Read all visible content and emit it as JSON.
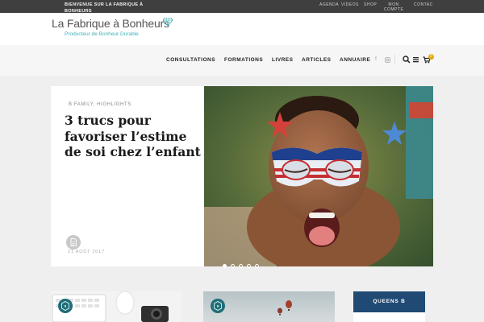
{
  "topbar": {
    "welcome": "BIENVENUE SUR LA FABRIQUE À BONHEURS",
    "links": [
      "AGENDA",
      "VIDEOS",
      "SHOP",
      "MON COMPTE",
      "CONTAC"
    ]
  },
  "header": {
    "logo_title": "La Fabrique à Bonheurs",
    "logo_sub": "Producteur de Bonheur Durable"
  },
  "nav": {
    "items": [
      "CONSULTATIONS",
      "FORMATIONS",
      "LIVRES",
      "ARTICLES",
      "ANNUAIRE"
    ],
    "cart_count": "0"
  },
  "hero": {
    "category": "B FAMILY, HIGHLIGHTS",
    "title": "3 trucs pour favoriser l’estime de soi chez l’enfant",
    "date": "21 AOÛT 2017",
    "slides": 5,
    "active_slide": 0
  },
  "widgets": {
    "queens_label": "QUEENS B"
  },
  "colors": {
    "accent_teal": "#3fb0b7",
    "badge_teal": "#1f6e78",
    "queens_blue": "#204a73",
    "topbar": "#3f3f3f",
    "cart_badge": "#e0a800"
  },
  "icons": [
    "gem-icon",
    "facebook-icon",
    "instagram-icon",
    "search-icon",
    "menu-icon",
    "cart-icon",
    "document-icon",
    "badge-icon"
  ]
}
